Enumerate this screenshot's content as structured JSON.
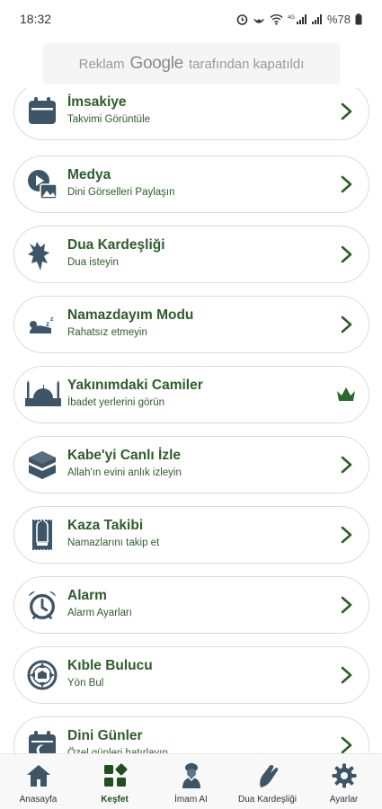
{
  "status": {
    "time": "18:32",
    "battery": "%78"
  },
  "ad": {
    "prefix": "Reklam",
    "brand": "Google",
    "suffix": "tarafından kapatıldı"
  },
  "menu": [
    {
      "title": "İmsakiye",
      "subtitle": "Takvimi Görüntüle",
      "icon": "calendar-icon",
      "trailing": "chevron"
    },
    {
      "title": "Medya",
      "subtitle": "Dini Görselleri Paylaşın",
      "icon": "media-icon",
      "trailing": "chevron"
    },
    {
      "title": "Dua Kardeşliği",
      "subtitle": "Dua isteyin",
      "icon": "dua-hands-icon",
      "trailing": "chevron"
    },
    {
      "title": "Namazdayım Modu",
      "subtitle": "Rahatsız etmeyin",
      "icon": "prayer-mode-icon",
      "trailing": "chevron"
    },
    {
      "title": "Yakınımdaki Camiler",
      "subtitle": "İbadet yerlerini görün",
      "icon": "mosque-icon",
      "trailing": "crown"
    },
    {
      "title": "Kabe'yi Canlı İzle",
      "subtitle": "Allah'ın evini anlık izleyin",
      "icon": "kaaba-icon",
      "trailing": "chevron"
    },
    {
      "title": "Kaza Takibi",
      "subtitle": "Namazlarını takip et",
      "icon": "prayer-rug-icon",
      "trailing": "chevron"
    },
    {
      "title": "Alarm",
      "subtitle": "Alarm Ayarları",
      "icon": "alarm-clock-icon",
      "trailing": "chevron"
    },
    {
      "title": "Kıble Bulucu",
      "subtitle": "Yön Bul",
      "icon": "compass-icon",
      "trailing": "chevron"
    },
    {
      "title": "Dini Günler",
      "subtitle": "Özel günleri hatırlayın",
      "icon": "religious-days-icon",
      "trailing": "chevron"
    }
  ],
  "nav": [
    {
      "label": "Anasayfa",
      "icon": "home-icon",
      "active": false
    },
    {
      "label": "Keşfet",
      "icon": "explore-grid-icon",
      "active": true
    },
    {
      "label": "İmam AI",
      "icon": "imam-icon",
      "active": false
    },
    {
      "label": "Dua Kardeşliği",
      "icon": "dua-hands-icon",
      "active": false
    },
    {
      "label": "Ayarlar",
      "icon": "gear-icon",
      "active": false
    }
  ],
  "colors": {
    "accent": "#2e5d2a",
    "icon": "#3d5566",
    "crown": "#2a6a2a",
    "card_border": "#d9ddd9"
  }
}
